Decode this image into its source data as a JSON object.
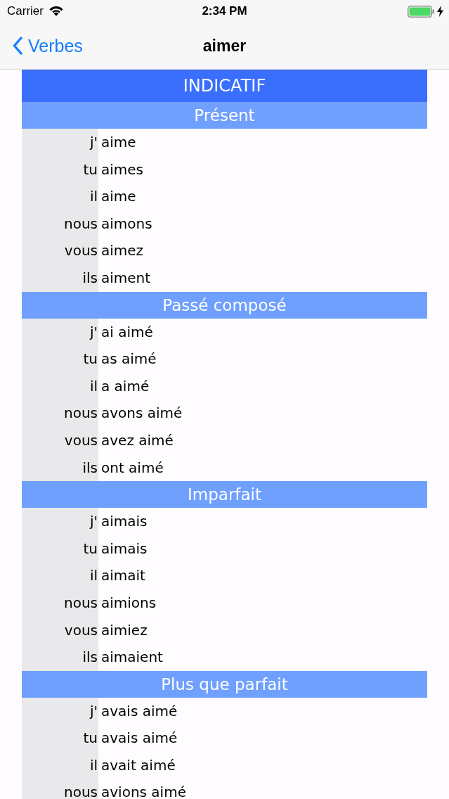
{
  "status_bar": {
    "carrier": "Carrier",
    "time": "2:34 PM"
  },
  "nav_bar": {
    "back_label": "Verbes",
    "title": "aimer"
  },
  "mood": {
    "title": "INDICATIF",
    "tenses": [
      {
        "name": "Présent",
        "rows": [
          {
            "pronoun": "j'",
            "form": "aime"
          },
          {
            "pronoun": "tu",
            "form": "aimes"
          },
          {
            "pronoun": "il",
            "form": "aime"
          },
          {
            "pronoun": "nous",
            "form": "aimons"
          },
          {
            "pronoun": "vous",
            "form": "aimez"
          },
          {
            "pronoun": "ils",
            "form": "aiment"
          }
        ]
      },
      {
        "name": "Passé composé",
        "rows": [
          {
            "pronoun": "j'",
            "form": "ai aimé"
          },
          {
            "pronoun": "tu",
            "form": "as aimé"
          },
          {
            "pronoun": "il",
            "form": "a aimé"
          },
          {
            "pronoun": "nous",
            "form": "avons aimé"
          },
          {
            "pronoun": "vous",
            "form": "avez aimé"
          },
          {
            "pronoun": "ils",
            "form": "ont aimé"
          }
        ]
      },
      {
        "name": "Imparfait",
        "rows": [
          {
            "pronoun": "j'",
            "form": "aimais"
          },
          {
            "pronoun": "tu",
            "form": "aimais"
          },
          {
            "pronoun": "il",
            "form": "aimait"
          },
          {
            "pronoun": "nous",
            "form": "aimions"
          },
          {
            "pronoun": "vous",
            "form": "aimiez"
          },
          {
            "pronoun": "ils",
            "form": "aimaient"
          }
        ]
      },
      {
        "name": "Plus que parfait",
        "rows": [
          {
            "pronoun": "j'",
            "form": "avais aimé"
          },
          {
            "pronoun": "tu",
            "form": "avais aimé"
          },
          {
            "pronoun": "il",
            "form": "avait aimé"
          },
          {
            "pronoun": "nous",
            "form": "avions aimé"
          }
        ]
      }
    ]
  }
}
